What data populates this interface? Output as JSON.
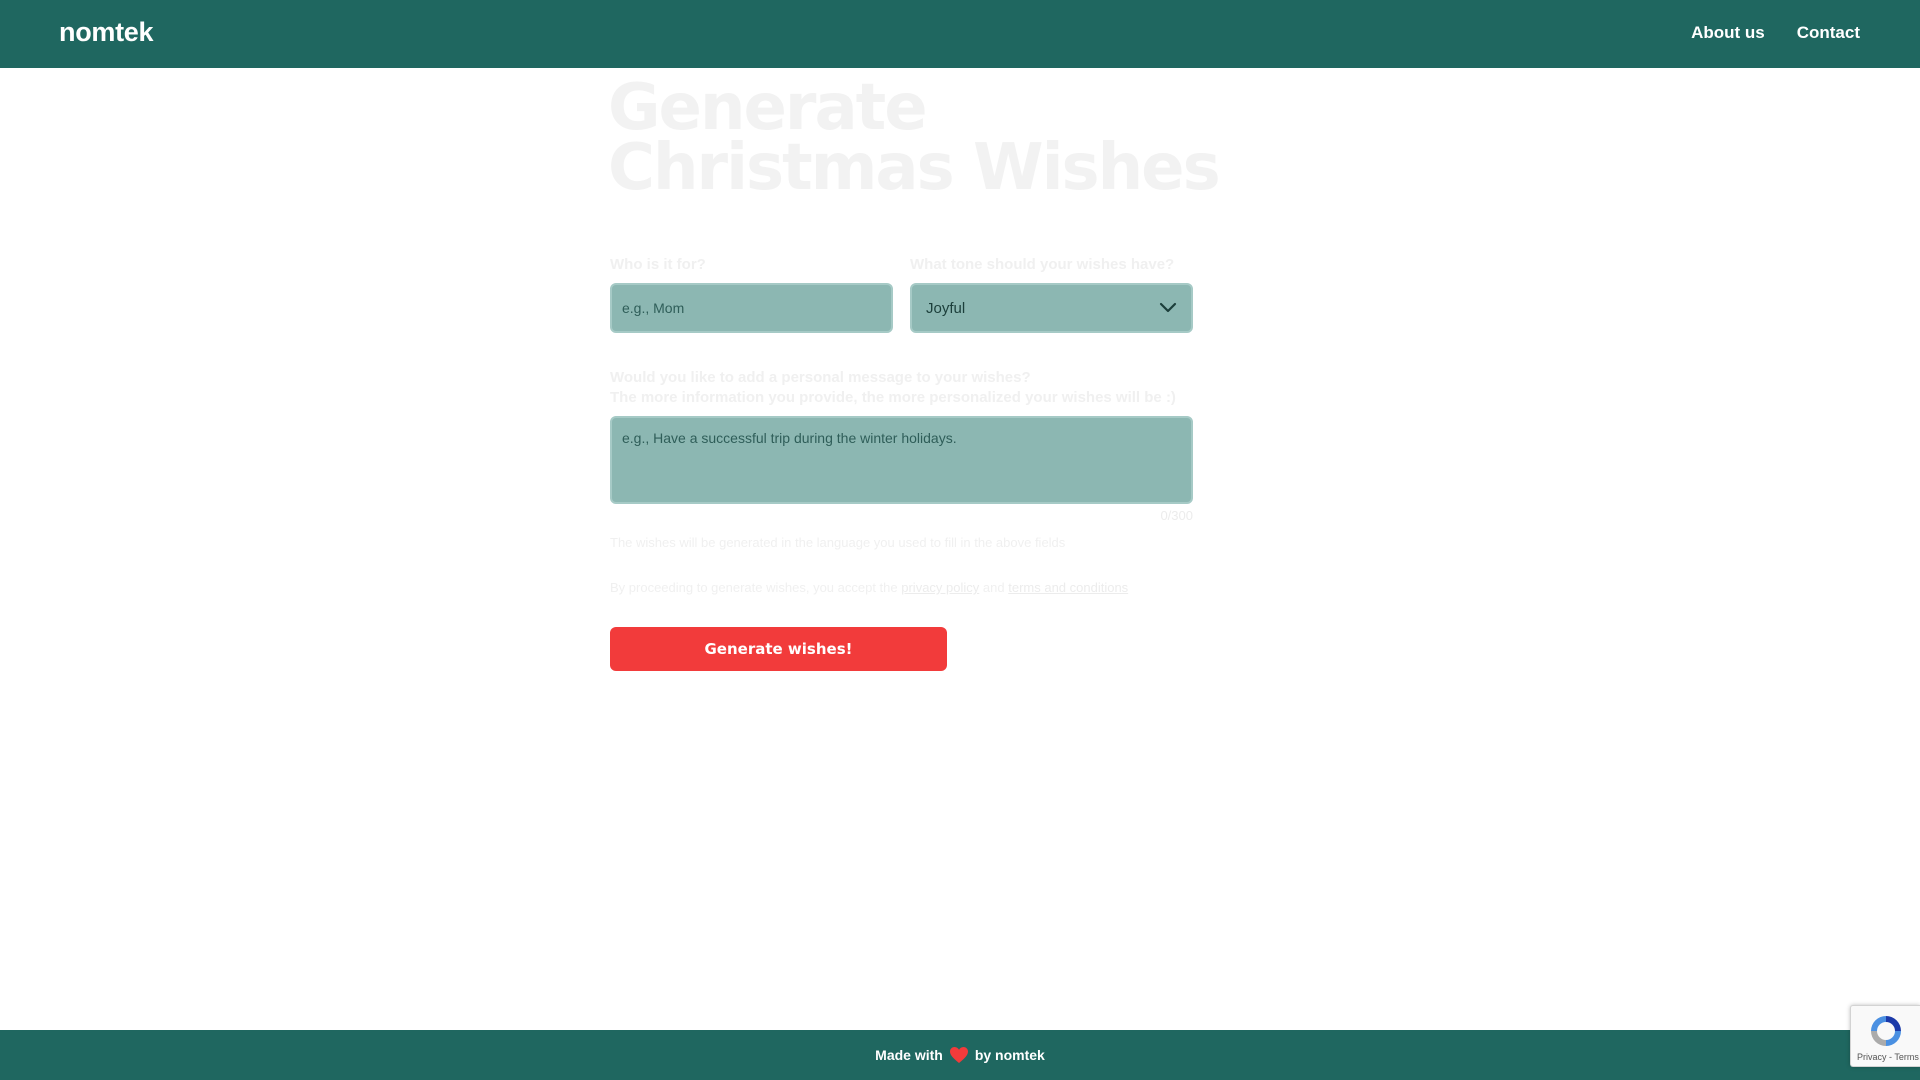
{
  "header": {
    "brand": "nomtek",
    "nav": [
      "About us",
      "Contact"
    ]
  },
  "hero": {
    "line1": "Generate",
    "line2": "Christmas Wishes"
  },
  "form": {
    "who_label": "Who is it for?",
    "who_placeholder": "e.g., Mom",
    "tone_label": "What tone should your wishes have?",
    "tone_value": "Joyful",
    "message_label_line1": "Would you like to add a personal message to your wishes?",
    "message_label_line2": "The more information you provide, the more personalized your wishes will be :)",
    "message_placeholder": "e.g., Have a successful trip during the winter holidays.",
    "counter": "0/300",
    "language_note": "The wishes will be generated in the language you used to fill in the above fields",
    "legal_prefix": "By proceeding to generate wishes, you accept the",
    "privacy_link": "privacy policy",
    "legal_and": "and",
    "terms_link": "terms and conditions",
    "submit_label": "Generate wishes!"
  },
  "footer": {
    "made_with": "Made with",
    "by": "by nomtek"
  },
  "recaptcha": {
    "terms": "Privacy - Terms"
  },
  "colors": {
    "brand_green": "#1f6760",
    "field_bg": "#8cb7b2",
    "cta_red": "#f23b3b",
    "heart": "#f23b3b"
  },
  "icons": {
    "select": "chevron-down-icon",
    "footer": "heart-icon",
    "recaptcha": "recaptcha-icon"
  }
}
